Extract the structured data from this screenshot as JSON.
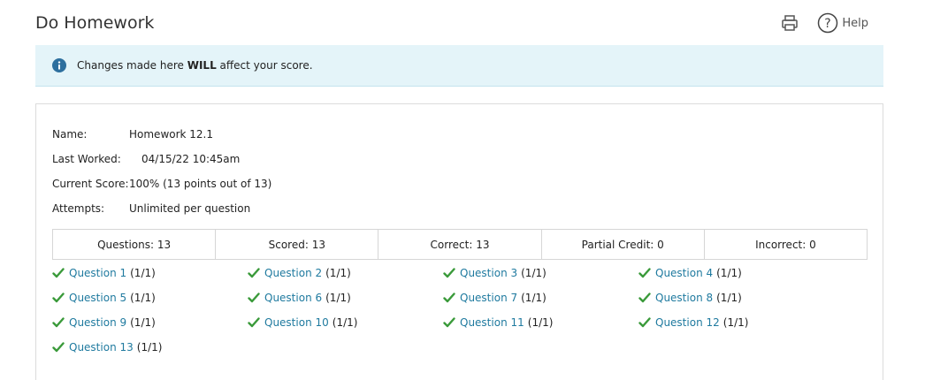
{
  "header": {
    "title": "Do Homework",
    "help_label": "Help",
    "print_icon": "printer-icon",
    "help_icon": "question-circle-icon"
  },
  "banner": {
    "icon": "info-icon",
    "text_before": "Changes made here ",
    "text_bold": "WILL",
    "text_after": " affect your score.",
    "background": "#e4f4f9"
  },
  "details": [
    {
      "label": "Name:",
      "value": "Homework 12.1"
    },
    {
      "label": "Last Worked:",
      "value": "04/15/22 10:45am"
    },
    {
      "label": "Current Score:",
      "value": "100% (13 points out of 13)"
    },
    {
      "label": "Attempts:",
      "value": "Unlimited per question"
    }
  ],
  "summary": [
    "Questions: 13",
    "Scored: 13",
    "Correct: 13",
    "Partial Credit: 0",
    "Incorrect: 0"
  ],
  "questions": [
    {
      "label": "Question 1",
      "score": "(1/1)"
    },
    {
      "label": "Question 2",
      "score": "(1/1)"
    },
    {
      "label": "Question 3",
      "score": "(1/1)"
    },
    {
      "label": "Question 4",
      "score": "(1/1)"
    },
    {
      "label": "Question 5",
      "score": "(1/1)"
    },
    {
      "label": "Question 6",
      "score": "(1/1)"
    },
    {
      "label": "Question 7",
      "score": "(1/1)"
    },
    {
      "label": "Question 8",
      "score": "(1/1)"
    },
    {
      "label": "Question 9",
      "score": "(1/1)"
    },
    {
      "label": "Question 10",
      "score": "(1/1)"
    },
    {
      "label": "Question 11",
      "score": "(1/1)"
    },
    {
      "label": "Question 12",
      "score": "(1/1)"
    },
    {
      "label": "Question 13",
      "score": "(1/1)"
    }
  ],
  "colors": {
    "link": "#1f7a9f",
    "check": "#3a9a3a",
    "info_icon": "#2d6f9e"
  }
}
